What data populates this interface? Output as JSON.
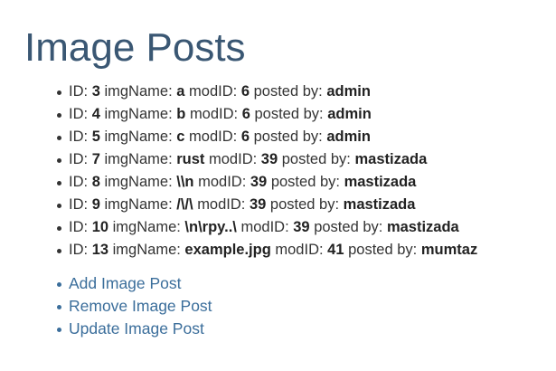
{
  "page": {
    "title": "Image Posts"
  },
  "labels": {
    "id": "ID:",
    "img_name": "imgName:",
    "mod_id": "modID:",
    "posted_by": "posted by:"
  },
  "posts": [
    {
      "id": "3",
      "img_name": "a",
      "mod_id": "6",
      "posted_by": "admin"
    },
    {
      "id": "4",
      "img_name": "b",
      "mod_id": "6",
      "posted_by": "admin"
    },
    {
      "id": "5",
      "img_name": "c",
      "mod_id": "6",
      "posted_by": "admin"
    },
    {
      "id": "7",
      "img_name": "rust",
      "mod_id": "39",
      "posted_by": "mastizada"
    },
    {
      "id": "8",
      "img_name": "\\\\n",
      "mod_id": "39",
      "posted_by": "mastizada"
    },
    {
      "id": "9",
      "img_name": "/\\/\\",
      "mod_id": "39",
      "posted_by": "mastizada"
    },
    {
      "id": "10",
      "img_name": "\\n\\rpy..\\",
      "mod_id": "39",
      "posted_by": "mastizada"
    },
    {
      "id": "13",
      "img_name": "example.jpg",
      "mod_id": "41",
      "posted_by": "mumtaz"
    }
  ],
  "links": [
    {
      "label": "Add Image Post"
    },
    {
      "label": "Remove Image Post"
    },
    {
      "label": "Update Image Post"
    }
  ],
  "colors": {
    "title": "#3a5773",
    "link": "#3b6e9b",
    "text": "#333333"
  }
}
